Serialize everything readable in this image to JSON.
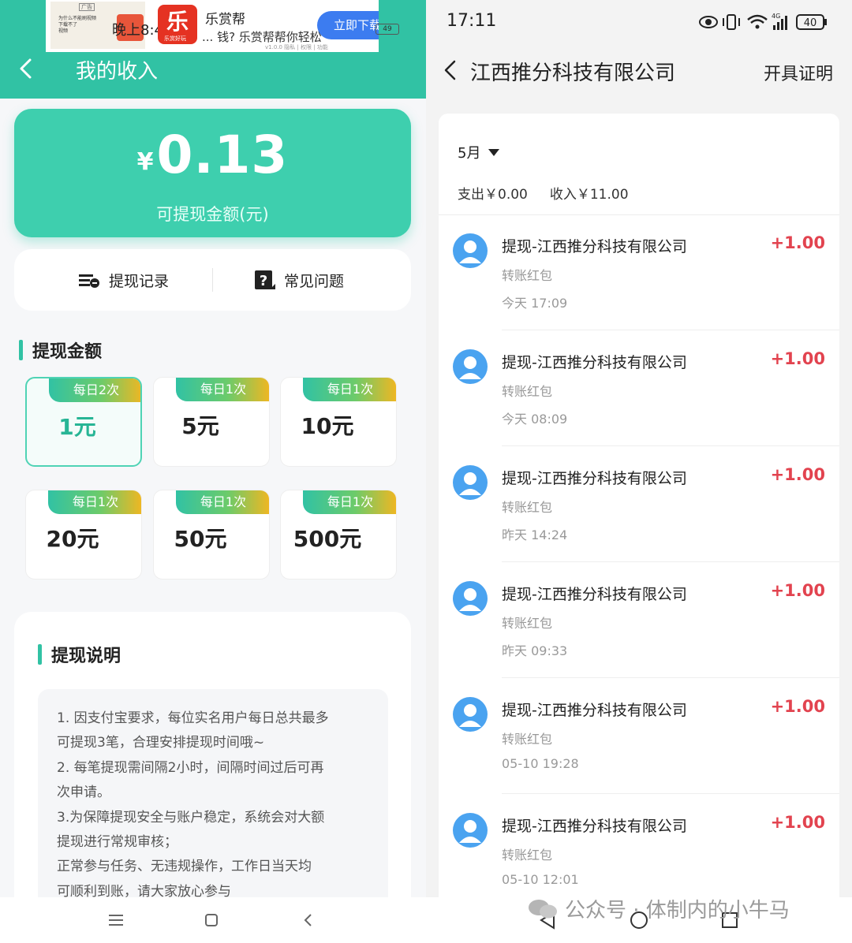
{
  "left": {
    "ad": {
      "thumb_tag": "广告",
      "thumb_lines": [
        "为什么不能刷视频",
        "下载不了",
        "视频"
      ],
      "overlay_time": "晚上8:40",
      "logo_char": "乐",
      "logo_sub": "乐赏好玩",
      "title": "乐赏帮",
      "desc": "... 钱? 乐赏帮帮你轻松",
      "small": "v1.0.0 隐私 | 权限 | 功能",
      "cta": "立即下载",
      "close": "×",
      "battery": "49"
    },
    "header": {
      "title": "我的收入"
    },
    "balance": {
      "currency": "¥",
      "amount": "0.13",
      "label": "可提现金额(元)"
    },
    "actions": {
      "record": "提现记录",
      "faq": "常见问题"
    },
    "amount_section": {
      "title": "提现金额",
      "options": [
        {
          "tag": "每日2次",
          "value": "1元",
          "selected": true
        },
        {
          "tag": "每日1次",
          "value": "5元",
          "selected": false
        },
        {
          "tag": "每日1次",
          "value": "10元",
          "selected": false
        },
        {
          "tag": "每日1次",
          "value": "20元",
          "selected": false
        },
        {
          "tag": "每日1次",
          "value": "50元",
          "selected": false
        },
        {
          "tag": "每日1次",
          "value": "500元",
          "selected": false
        }
      ]
    },
    "notes": {
      "title": "提现说明",
      "lines": [
        "1. 因支付宝要求，每位实名用户每日总共最多",
        "可提现3笔，合理安排提现时间哦~",
        "2. 每笔提现需间隔2小时，间隔时间过后可再",
        "次申请。",
        "3.为保障提现安全与账户稳定，系统会对大额",
        "提现进行常规审核；",
        "正常参与任务、无违规操作，工作日当天均",
        "可顺利到账，请大家放心参与"
      ]
    }
  },
  "right": {
    "status": {
      "time": "17:11",
      "battery": "40"
    },
    "header": {
      "title": "江西推分科技有限公司",
      "action": "开具证明"
    },
    "filter": {
      "month": "5月"
    },
    "summary": {
      "expense": "支出￥0.00",
      "income": "收入￥11.00"
    },
    "transactions": [
      {
        "title": "提现-江西推分科技有限公司",
        "amount": "+1.00",
        "type": "转账红包",
        "time": "今天 17:09"
      },
      {
        "title": "提现-江西推分科技有限公司",
        "amount": "+1.00",
        "type": "转账红包",
        "time": "今天 08:09"
      },
      {
        "title": "提现-江西推分科技有限公司",
        "amount": "+1.00",
        "type": "转账红包",
        "time": "昨天 14:24"
      },
      {
        "title": "提现-江西推分科技有限公司",
        "amount": "+1.00",
        "type": "转账红包",
        "time": "昨天 09:33"
      },
      {
        "title": "提现-江西推分科技有限公司",
        "amount": "+1.00",
        "type": "转账红包",
        "time": "05-10 19:28"
      },
      {
        "title": "提现-江西推分科技有限公司",
        "amount": "+1.00",
        "type": "转账红包",
        "time": "05-10 12:01"
      }
    ],
    "watermark": "公众号 · 体制内的小牛马"
  },
  "colors": {
    "accent": "#31c2a4",
    "card": "#3ecfae",
    "amount_red": "#e2434f",
    "avatar_blue": "#4aa3f0",
    "tag_orange": "#f3b620"
  }
}
